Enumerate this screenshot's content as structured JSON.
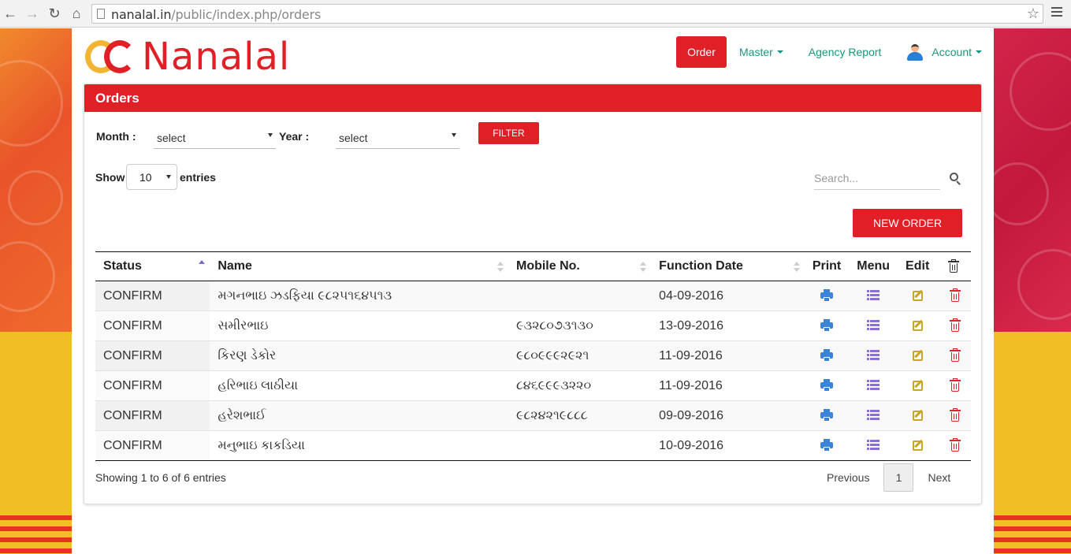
{
  "browser": {
    "url_host": "nanalal.in",
    "url_path": "/public/index.php/orders"
  },
  "brand": {
    "name": "Nanalal"
  },
  "nav": {
    "order": "Order",
    "master": "Master",
    "agency_report": "Agency Report",
    "account": "Account"
  },
  "panel": {
    "title": "Orders"
  },
  "filters": {
    "month_label": "Month :",
    "month_value": "select",
    "year_label": "Year :",
    "year_value": "select",
    "filter_button": "FILTER"
  },
  "table_controls": {
    "show_label": "Show",
    "entries_value": "10",
    "entries_label": "entries",
    "search_placeholder": "Search...",
    "new_order_button": "NEW ORDER"
  },
  "table": {
    "headers": [
      "Status",
      "Name",
      "Mobile No.",
      "Function Date",
      "Print",
      "Menu",
      "Edit"
    ],
    "rows": [
      {
        "status": "CONFIRM",
        "name": "મગનભાઇ ઝડફિયા ૯૮૨૫૧૬૪૫૧૩",
        "mobile": "",
        "date": "04-09-2016"
      },
      {
        "status": "CONFIRM",
        "name": "સમીરભાઇ",
        "mobile": "૯૩૨૮૦૭૩૧૩૦",
        "date": "13-09-2016"
      },
      {
        "status": "CONFIRM",
        "name": "કિરણ ડેકોર",
        "mobile": "૯૮૦૯૯૯૨૯૨૧",
        "date": "11-09-2016"
      },
      {
        "status": "CONFIRM",
        "name": "હરિભાઇ લાઠીયા",
        "mobile": "૮૪૬૯૯૯૩૨૨૦",
        "date": "11-09-2016"
      },
      {
        "status": "CONFIRM",
        "name": "હરેશભાઈ",
        "mobile": "૯૮૨૪૨૧૯૮૮૮",
        "date": "09-09-2016"
      },
      {
        "status": "CONFIRM",
        "name": "મનુભાઇ કાકડિયા",
        "mobile": "",
        "date": "10-09-2016"
      }
    ]
  },
  "footer": {
    "info": "Showing 1 to 6 of 6 entries",
    "previous": "Previous",
    "page": "1",
    "next": "Next"
  },
  "colors": {
    "brand_red": "#e01f26",
    "nav_teal": "#19967e",
    "print_blue": "#3b83d8",
    "menu_purple": "#8a70d6",
    "edit_gold": "#c9a724"
  }
}
